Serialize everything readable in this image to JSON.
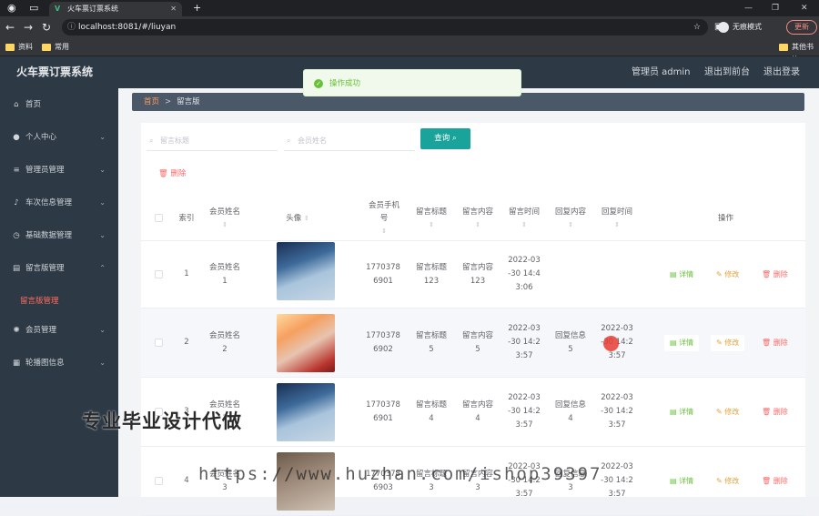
{
  "browser": {
    "tab_title": "火车票订票系统",
    "url": "localhost:8081/#/liuyan",
    "incognito_label": "无痕模式",
    "update_label": "更新",
    "bookmarks": [
      "资料",
      "常用",
      "其他书签"
    ],
    "tab_icon": "V"
  },
  "header": {
    "brand": "火车票订票系统",
    "admin": "管理员 admin",
    "back": "退出到前台",
    "logout": "退出登录"
  },
  "sidebar": {
    "items": [
      {
        "label": "首页",
        "icon": "home-icon"
      },
      {
        "label": "个人中心",
        "icon": "user-icon"
      },
      {
        "label": "管理员管理",
        "icon": "list-icon"
      },
      {
        "label": "车次信息管理",
        "icon": "mic-icon"
      },
      {
        "label": "基础数据管理",
        "icon": "clock-icon"
      },
      {
        "label": "留言版管理",
        "icon": "clipboard-icon"
      },
      {
        "label": "会员管理",
        "icon": "settings-icon"
      },
      {
        "label": "轮播图信息",
        "icon": "grid-icon"
      }
    ],
    "submenu": "留言版管理"
  },
  "breadcrumb": {
    "home": "首页",
    "current": "留言版"
  },
  "toast": "操作成功",
  "search": {
    "title_placeholder": "留言标题",
    "name_placeholder": "会员姓名",
    "query_label": "查询"
  },
  "delete_label": "删除",
  "table": {
    "headers": {
      "index": "索引",
      "name": "会员姓名",
      "avatar": "头像",
      "phone": "会员手机\n号",
      "title": "留言标题",
      "content": "留言内容",
      "time": "留言时间",
      "reply": "回复内容",
      "reply_time": "回复时间",
      "ops": "操作"
    },
    "rows": [
      {
        "index": "1",
        "name": "会员姓名\n1",
        "phone": "1770378\n6901",
        "title": "留言标题\n123",
        "content": "留言内容\n123",
        "time": "2022-03\n-30 14:4\n3:06",
        "reply": "",
        "reply_time": ""
      },
      {
        "index": "2",
        "name": "会员姓名\n2",
        "phone": "1770378\n6902",
        "title": "留言标题\n5",
        "content": "留言内容\n5",
        "time": "2022-03\n-30 14:2\n3:57",
        "reply": "回复信息\n5",
        "reply_time": "2022-03\n-30 14:2\n3:57"
      },
      {
        "index": "3",
        "name": "会员姓名\n3",
        "phone": "1770378\n6901",
        "title": "留言标题\n4",
        "content": "留言内容\n4",
        "time": "2022-03\n-30 14:2\n3:57",
        "reply": "回复信息\n4",
        "reply_time": "2022-03\n-30 14:2\n3:57"
      },
      {
        "index": "4",
        "name": "会员姓名\n3",
        "phone": "1770378\n6903",
        "title": "留言标题\n3",
        "content": "留言内容\n3",
        "time": "2022-03\n-30 14:2\n3:57",
        "reply": "回复信息\n3",
        "reply_time": "2022-03\n-30 14:2\n3:57"
      }
    ],
    "actions": {
      "detail": "详情",
      "edit": "修改",
      "delete": "删除"
    }
  },
  "watermark": {
    "line1": "专业毕业设计代做",
    "line2": "https://www.huzhan.com/ishop39397"
  }
}
